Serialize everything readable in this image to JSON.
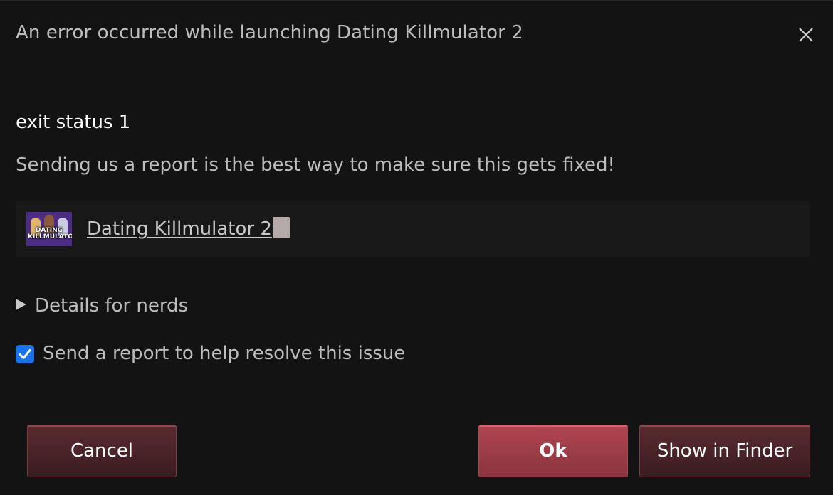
{
  "dialog": {
    "title": "An error occurred while launching Dating Killmulator 2",
    "status": "exit status 1",
    "subtitle": "Sending us a report is the best way to make sure this gets fixed!",
    "game": {
      "name": "Dating Killmulator 2",
      "thumbnail_icon": "game-cover-thumbnail",
      "thumbnail_caption": "DATING KILLMULATOR"
    },
    "details_label": "Details for nerds",
    "report": {
      "label": "Send a report to help resolve this issue",
      "checked": true
    },
    "buttons": {
      "cancel": "Cancel",
      "ok": "Ok",
      "show_in_finder": "Show in Finder"
    }
  },
  "colors": {
    "background": "#131313",
    "primary_button": "#a8414b",
    "secondary_button": "#4a2428",
    "checkbox": "#1a73e8"
  }
}
